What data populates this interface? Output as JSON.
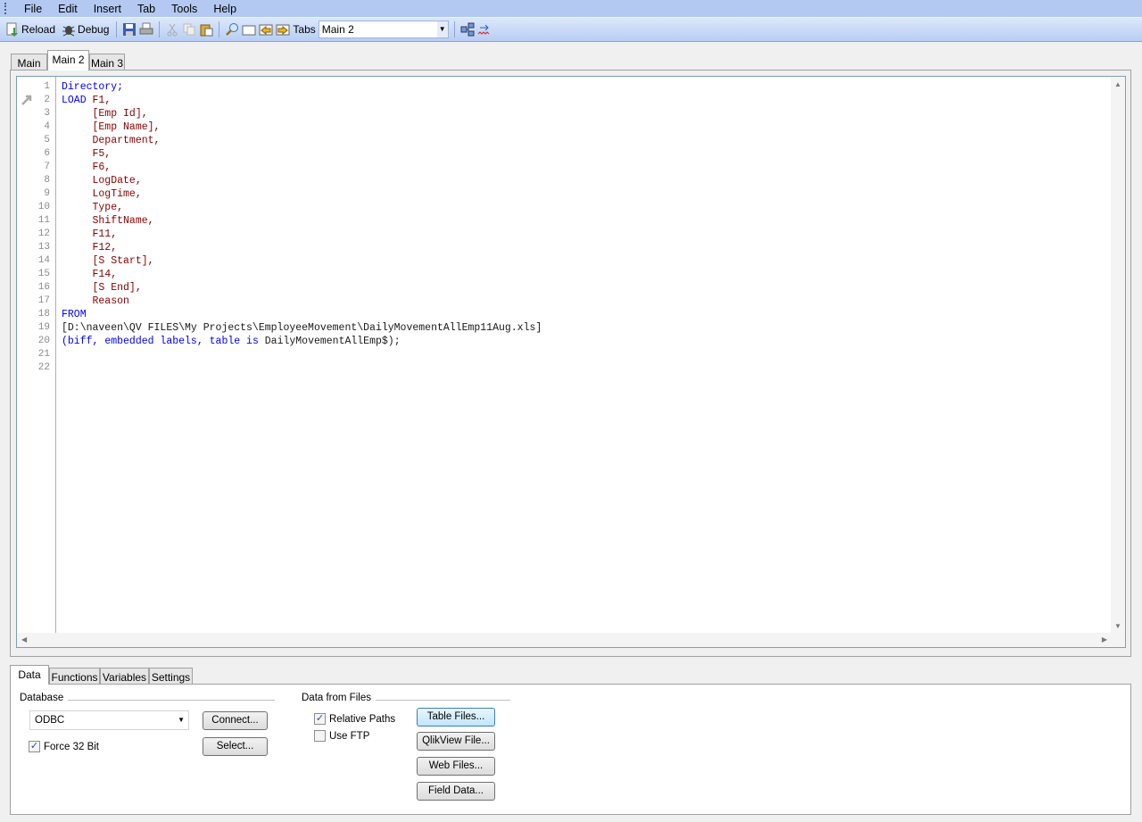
{
  "menu": [
    "File",
    "Edit",
    "Insert",
    "Tab",
    "Tools",
    "Help"
  ],
  "toolbar": {
    "reload": "Reload",
    "debug": "Debug",
    "tabs_label": "Tabs",
    "tabs_value": "Main 2"
  },
  "script_tabs": [
    {
      "label": "Main",
      "active": false
    },
    {
      "label": "Main 2",
      "active": true
    },
    {
      "label": "Main 3",
      "active": false
    }
  ],
  "code_lines": [
    [
      [
        "Directory;",
        "kw"
      ]
    ],
    [
      [
        "LOAD ",
        "kw"
      ],
      [
        "F1,",
        "fld"
      ]
    ],
    [
      [
        "     [Emp Id],",
        "fld"
      ]
    ],
    [
      [
        "     [Emp Name],",
        "fld"
      ]
    ],
    [
      [
        "     Department,",
        "fld"
      ]
    ],
    [
      [
        "     F5,",
        "fld"
      ]
    ],
    [
      [
        "     F6,",
        "fld"
      ]
    ],
    [
      [
        "     LogDate,",
        "fld"
      ]
    ],
    [
      [
        "     LogTime,",
        "fld"
      ]
    ],
    [
      [
        "     Type,",
        "fld"
      ]
    ],
    [
      [
        "     ShiftName,",
        "fld"
      ]
    ],
    [
      [
        "     F11,",
        "fld"
      ]
    ],
    [
      [
        "     F12,",
        "fld"
      ]
    ],
    [
      [
        "     [S Start],",
        "fld"
      ]
    ],
    [
      [
        "     F14,",
        "fld"
      ]
    ],
    [
      [
        "     [S End],",
        "fld"
      ]
    ],
    [
      [
        "     Reason",
        "fld"
      ]
    ],
    [
      [
        "FROM",
        "kw"
      ]
    ],
    [
      [
        "[D:\\naveen\\QV FILES\\My Projects\\EmployeeMovement\\DailyMovementAllEmp11Aug.xls]",
        "plain"
      ]
    ],
    [
      [
        "(biff, ",
        "kw"
      ],
      [
        "embedded labels, ",
        "kw"
      ],
      [
        "table is ",
        "kw"
      ],
      [
        "DailyMovementAllEmp$);",
        "plain"
      ]
    ],
    [],
    []
  ],
  "bottom_tabs": [
    {
      "label": "Data",
      "active": true
    },
    {
      "label": "Functions",
      "active": false
    },
    {
      "label": "Variables",
      "active": false
    },
    {
      "label": "Settings",
      "active": false
    }
  ],
  "database": {
    "label": "Database",
    "driver": "ODBC",
    "connect": "Connect...",
    "select": "Select...",
    "force32": "Force 32 Bit",
    "force32_checked": true
  },
  "files": {
    "label": "Data from Files",
    "relative_paths": "Relative Paths",
    "relative_checked": true,
    "use_ftp": "Use FTP",
    "ftp_checked": false,
    "buttons": [
      "Table Files...",
      "QlikView File...",
      "Web Files...",
      "Field Data..."
    ]
  }
}
